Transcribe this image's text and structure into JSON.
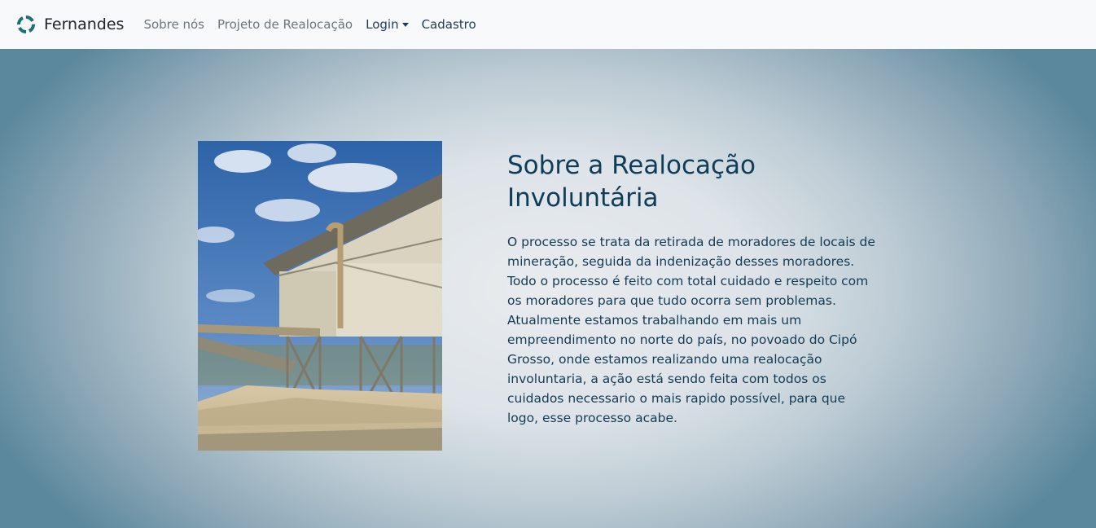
{
  "nav": {
    "brand": "Fernandes",
    "brand_icon": "logo-icon",
    "links": [
      "Sobre nós",
      "Projeto de Realocação"
    ],
    "login": "Login",
    "signup": "Cadastro"
  },
  "main": {
    "title_line1": "Sobre a Realocação",
    "title_line2": "Involuntária",
    "description": "O processo se trata da retirada de moradores de locais de mineração, seguida da indenização desses moradores. Todo o processo é feito com total cuidado e respeito com os moradores para que tudo ocorra sem problemas. Atualmente estamos trabalhando em mais um empreendimento no norte do país, no povoado do Cipó Grosso, onde estamos realizando uma realocação involuntaria, a ação está sendo feita com todos os cuidados necessario o mais rapido possível, para que logo, esse processo acabe."
  },
  "colors": {
    "accent": "#0e3d5a",
    "nav_bg": "#f8f9fa"
  }
}
